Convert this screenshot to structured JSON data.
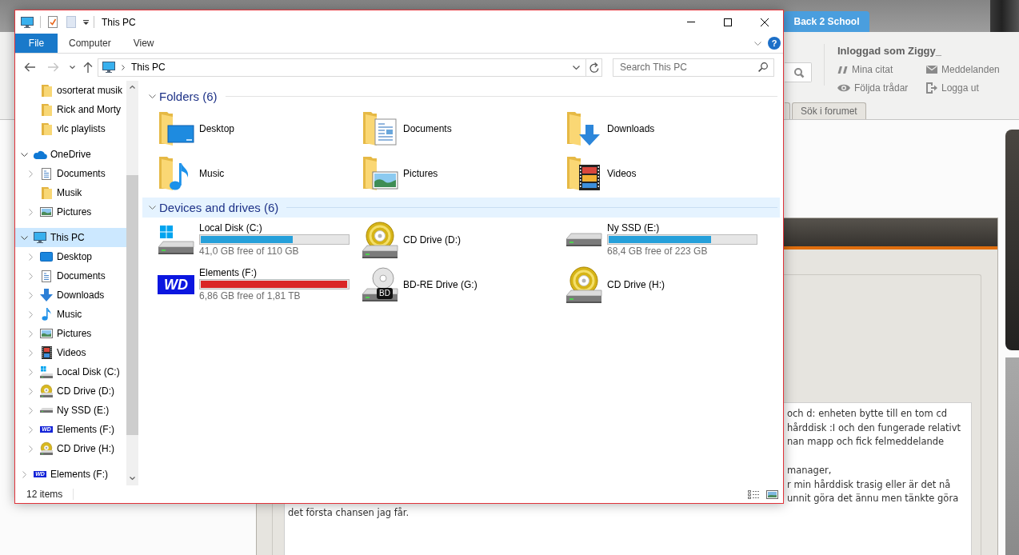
{
  "browser_page": {
    "banner": {
      "tab": "Back 2 School"
    },
    "user_panel": {
      "greeting": "Inloggad som Ziggy_",
      "links": [
        {
          "label": "Mina citat",
          "kind": "quotes"
        },
        {
          "label": "Meddelanden",
          "kind": "messages"
        },
        {
          "label": "Följda trådar",
          "kind": "watched"
        },
        {
          "label": "Logga ut",
          "kind": "logout"
        }
      ]
    },
    "forum_tabs": [
      {
        "label": "Sök i forumet"
      }
    ],
    "post": {
      "paragraphs": [
        {
          "lines": [
            {
              "text": "och d: enheten bytte till en tom cd",
              "kind": "tail"
            },
            {
              "text": "hårddisk :I och den fungerade relativt",
              "kind": "tail"
            },
            {
              "text": "nan mapp och fick felmeddelande",
              "kind": "tail"
            }
          ]
        },
        {
          "lines": [
            {
              "text": "manager,",
              "kind": "tail"
            },
            {
              "text": "r min hårddisk trasig eller är det nå",
              "kind": "tail"
            },
            {
              "text": "unnit göra det ännu men tänkte göra",
              "kind": "tail"
            },
            {
              "text": "det första chansen jag får.",
              "kind": "whole"
            }
          ]
        }
      ]
    }
  },
  "explorer": {
    "title": "This PC",
    "ribbon": {
      "tabs": [
        {
          "label": "File",
          "kind": "file"
        },
        {
          "label": "Computer",
          "kind": "tab"
        },
        {
          "label": "View",
          "kind": "tab"
        }
      ],
      "help": "?"
    },
    "navigation": {
      "buttons": [
        {
          "kind": "back",
          "disabled": false
        },
        {
          "kind": "forward",
          "disabled": true
        },
        {
          "kind": "recent",
          "disabled": false
        },
        {
          "kind": "up",
          "disabled": false
        }
      ],
      "location": "This PC",
      "search": {
        "placeholder": "Search This PC"
      }
    },
    "nav_pane": {
      "partial_group_children": [
        {
          "label": "osorterat musik",
          "kind": "folder",
          "selected": false
        },
        {
          "label": "Rick and Morty",
          "kind": "folder",
          "selected": false
        },
        {
          "label": "vlc playlists",
          "kind": "folder",
          "selected": false
        }
      ],
      "tree": [
        {
          "label": "OneDrive",
          "kind": "cloud",
          "expanded": true,
          "selected": false,
          "children": [
            {
              "label": "Documents",
              "kind": "documents",
              "expanded": false,
              "selected": false
            },
            {
              "label": "Musik",
              "kind": "folder",
              "selected": false
            },
            {
              "label": "Pictures",
              "kind": "pictures",
              "expanded": false,
              "selected": false
            }
          ]
        },
        {
          "label": "This PC",
          "kind": "pc",
          "expanded": true,
          "selected": true,
          "children": [
            {
              "label": "Desktop",
              "kind": "desktop",
              "expanded": false,
              "selected": false
            },
            {
              "label": "Documents",
              "kind": "documents",
              "expanded": false,
              "selected": false
            },
            {
              "label": "Downloads",
              "kind": "downloads",
              "expanded": false,
              "selected": false
            },
            {
              "label": "Music",
              "kind": "music",
              "expanded": false,
              "selected": false
            },
            {
              "label": "Pictures",
              "kind": "pictures",
              "expanded": false,
              "selected": false
            },
            {
              "label": "Videos",
              "kind": "videos",
              "expanded": false,
              "selected": false
            },
            {
              "label": "Local Disk (C:)",
              "kind": "system-disk",
              "expanded": false,
              "selected": false
            },
            {
              "label": "CD Drive (D:)",
              "kind": "cd",
              "expanded": false,
              "selected": false
            },
            {
              "label": "Ny SSD (E:)",
              "kind": "disk",
              "expanded": false,
              "selected": false
            },
            {
              "label": "Elements (F:)",
              "kind": "wd",
              "logo": "WD",
              "expanded": false,
              "selected": false
            },
            {
              "label": "CD Drive (H:)",
              "kind": "cd",
              "expanded": false,
              "selected": false
            }
          ]
        },
        {
          "label": "Elements (F:)",
          "kind": "wd",
          "logo": "WD",
          "expanded": false,
          "selected": false
        }
      ]
    },
    "sections": [
      {
        "title": "Folders (6)",
        "kind": "folders",
        "expanded": true,
        "highlighted": false,
        "items": [
          {
            "label": "Desktop",
            "kind": "desktop"
          },
          {
            "label": "Documents",
            "kind": "documents"
          },
          {
            "label": "Downloads",
            "kind": "downloads"
          },
          {
            "label": "Music",
            "kind": "music"
          },
          {
            "label": "Pictures",
            "kind": "pictures"
          },
          {
            "label": "Videos",
            "kind": "videos"
          }
        ]
      },
      {
        "title": "Devices and drives (6)",
        "kind": "drives",
        "expanded": true,
        "highlighted": true,
        "items": [
          {
            "label": "Local Disk (C:)",
            "kind": "system-disk",
            "level": 0.627,
            "free_space": "41,0 GB free of 110 GB"
          },
          {
            "label": "CD Drive (D:)",
            "kind": "cd"
          },
          {
            "label": "Ny SSD (E:)",
            "kind": "disk",
            "level": 0.693,
            "free_space": "68,4 GB free of 223 GB"
          },
          {
            "label": "Elements (F:)",
            "kind": "wd",
            "logo": "WD",
            "level": 0.996,
            "free_space": "6,86 GB free of 1,81 TB"
          },
          {
            "label": "BD-RE Drive (G:)",
            "kind": "bd",
            "logo": "BD"
          },
          {
            "label": "CD Drive (H:)",
            "kind": "cd"
          }
        ]
      }
    ],
    "status_bar": {
      "item_count": "12 items"
    }
  }
}
